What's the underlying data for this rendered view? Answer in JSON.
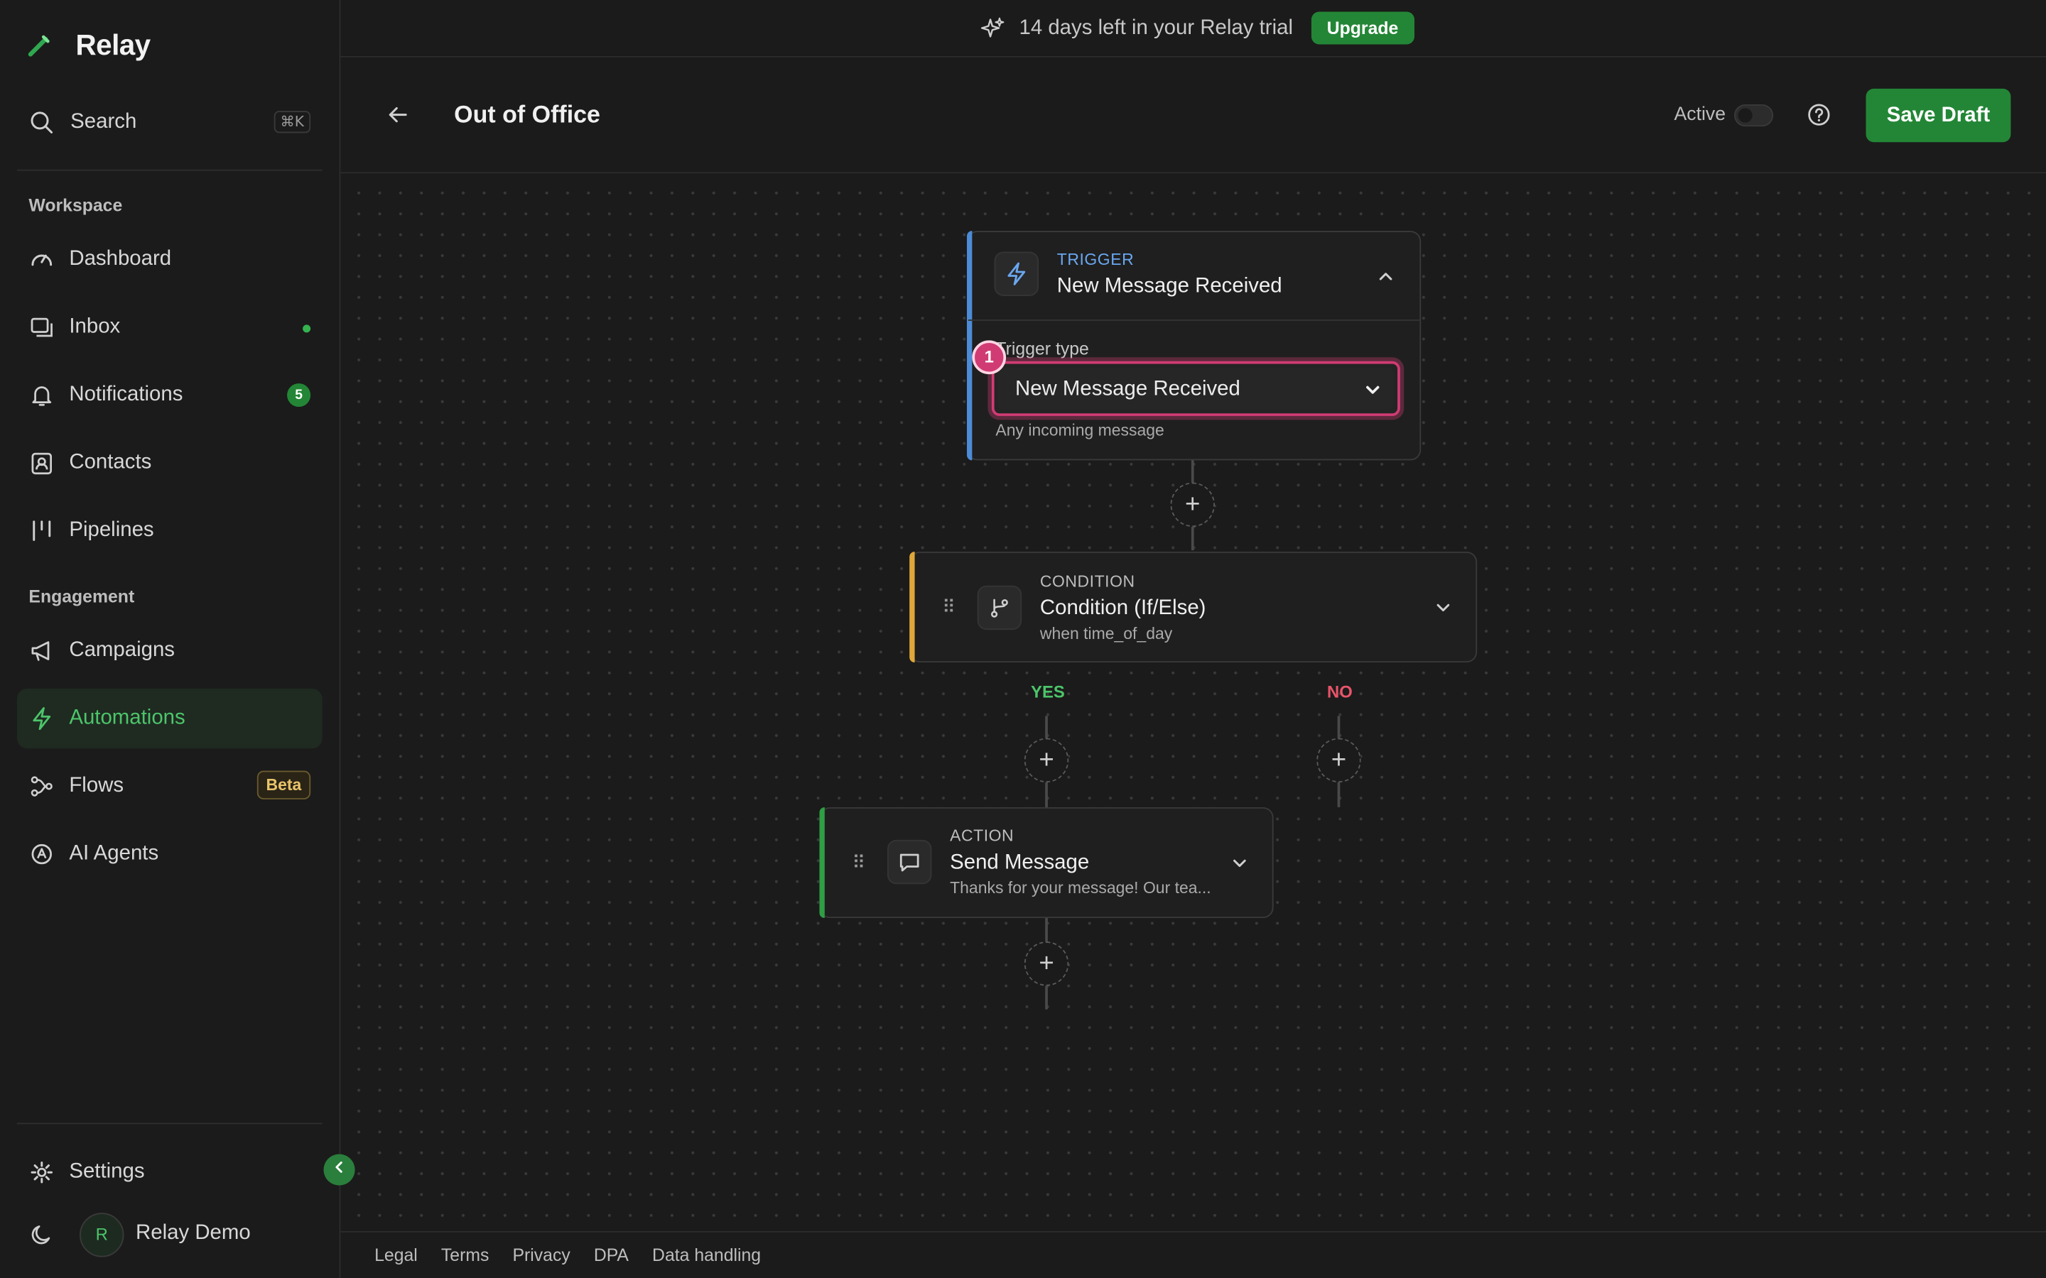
{
  "app": {
    "name": "Relay"
  },
  "sidebar": {
    "search": {
      "label": "Search",
      "shortcut": "⌘K"
    },
    "sections": {
      "workspace": "Workspace",
      "engagement": "Engagement"
    },
    "items": [
      {
        "label": "Dashboard",
        "icon": "gauge-icon"
      },
      {
        "label": "Inbox",
        "icon": "inbox-icon",
        "indicator": "unread-dot"
      },
      {
        "label": "Notifications",
        "icon": "bell-icon",
        "badge": "5"
      },
      {
        "label": "Contacts",
        "icon": "contacts-icon"
      },
      {
        "label": "Pipelines",
        "icon": "pipelines-icon"
      },
      {
        "label": "Campaigns",
        "icon": "megaphone-icon"
      },
      {
        "label": "Automations",
        "icon": "lightning-icon",
        "active": true
      },
      {
        "label": "Flows",
        "icon": "flows-icon",
        "badge": "Beta"
      },
      {
        "label": "AI Agents",
        "icon": "ai-agent-icon"
      }
    ],
    "settings": "Settings",
    "user": {
      "initial": "R",
      "name": "Relay Demo"
    }
  },
  "banner": {
    "text": "14 days left in your Relay trial",
    "upgrade": "Upgrade"
  },
  "header": {
    "title": "Out of Office",
    "active_label": "Active",
    "active": false,
    "save": "Save Draft"
  },
  "flow": {
    "trigger": {
      "type": "TRIGGER",
      "title": "New Message Received",
      "field_label": "Trigger type",
      "selected": "New Message Received",
      "help": "Any incoming message",
      "marker": "1"
    },
    "condition": {
      "type": "CONDITION",
      "title": "Condition (If/Else)",
      "subtitle": "when time_of_day"
    },
    "branches": {
      "yes": "YES",
      "no": "NO"
    },
    "action": {
      "type": "ACTION",
      "title": "Send Message",
      "subtitle": "Thanks for your message! Our tea..."
    }
  },
  "footer": {
    "links": [
      "Legal",
      "Terms",
      "Privacy",
      "DPA",
      "Data handling"
    ]
  },
  "colors": {
    "accent_green": "#238636",
    "active_green": "#4cc56a",
    "trigger_blue": "#4c8bd6",
    "condition_amber": "#e0a83a",
    "action_green": "#2f9e44",
    "highlight_pink": "#d13b73",
    "no_red": "#e8546a"
  }
}
